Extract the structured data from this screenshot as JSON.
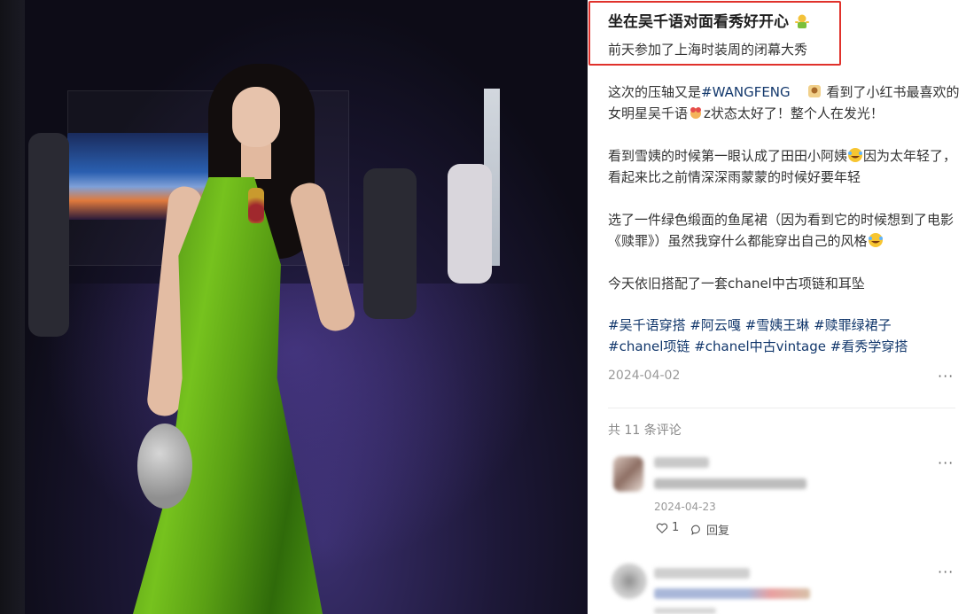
{
  "post": {
    "title": "坐在吴千语对面看秀好开心",
    "subtitle": "前天参加了上海时装周的闭幕大秀",
    "paragraphs": {
      "p1": {
        "a": "这次的压轴又是",
        "tag": "#WANGFENG",
        "b": "看到了小红书最喜欢的女明星吴千语",
        "c": "z状态太好了！整个人在发光！"
      },
      "p2": {
        "a": "看到雪姨的时候第一眼认成了田田小阿姨",
        "b": "因为太年轻了，看起来比之前情深深雨蒙蒙的时候好要年轻"
      },
      "p3": {
        "a": "选了一件绿色缎面的鱼尾裙（因为看到它的时候想到了电影《赎罪》）虽然我穿什么都能穿出自己的风格"
      },
      "p4": "今天依旧搭配了一套chanel中古项链和耳坠"
    },
    "tags": [
      "#吴千语穿搭",
      "#阿云嘎",
      "#雪姨王琳",
      "#赎罪绿裙子",
      "#chanel项链",
      "#chanel中古vintage",
      "#看秀学穿搭"
    ],
    "date": "2024-04-02",
    "more": "···"
  },
  "comments": {
    "count_label": "共 11 条评论",
    "items": [
      {
        "date": "2024-04-23",
        "likes": "1",
        "reply_label": "回复",
        "more": "···"
      },
      {
        "more": "···"
      }
    ]
  },
  "colors": {
    "highlight_border": "#e0312b",
    "tag_color": "#13386c",
    "dress_green": "#5aa014"
  }
}
